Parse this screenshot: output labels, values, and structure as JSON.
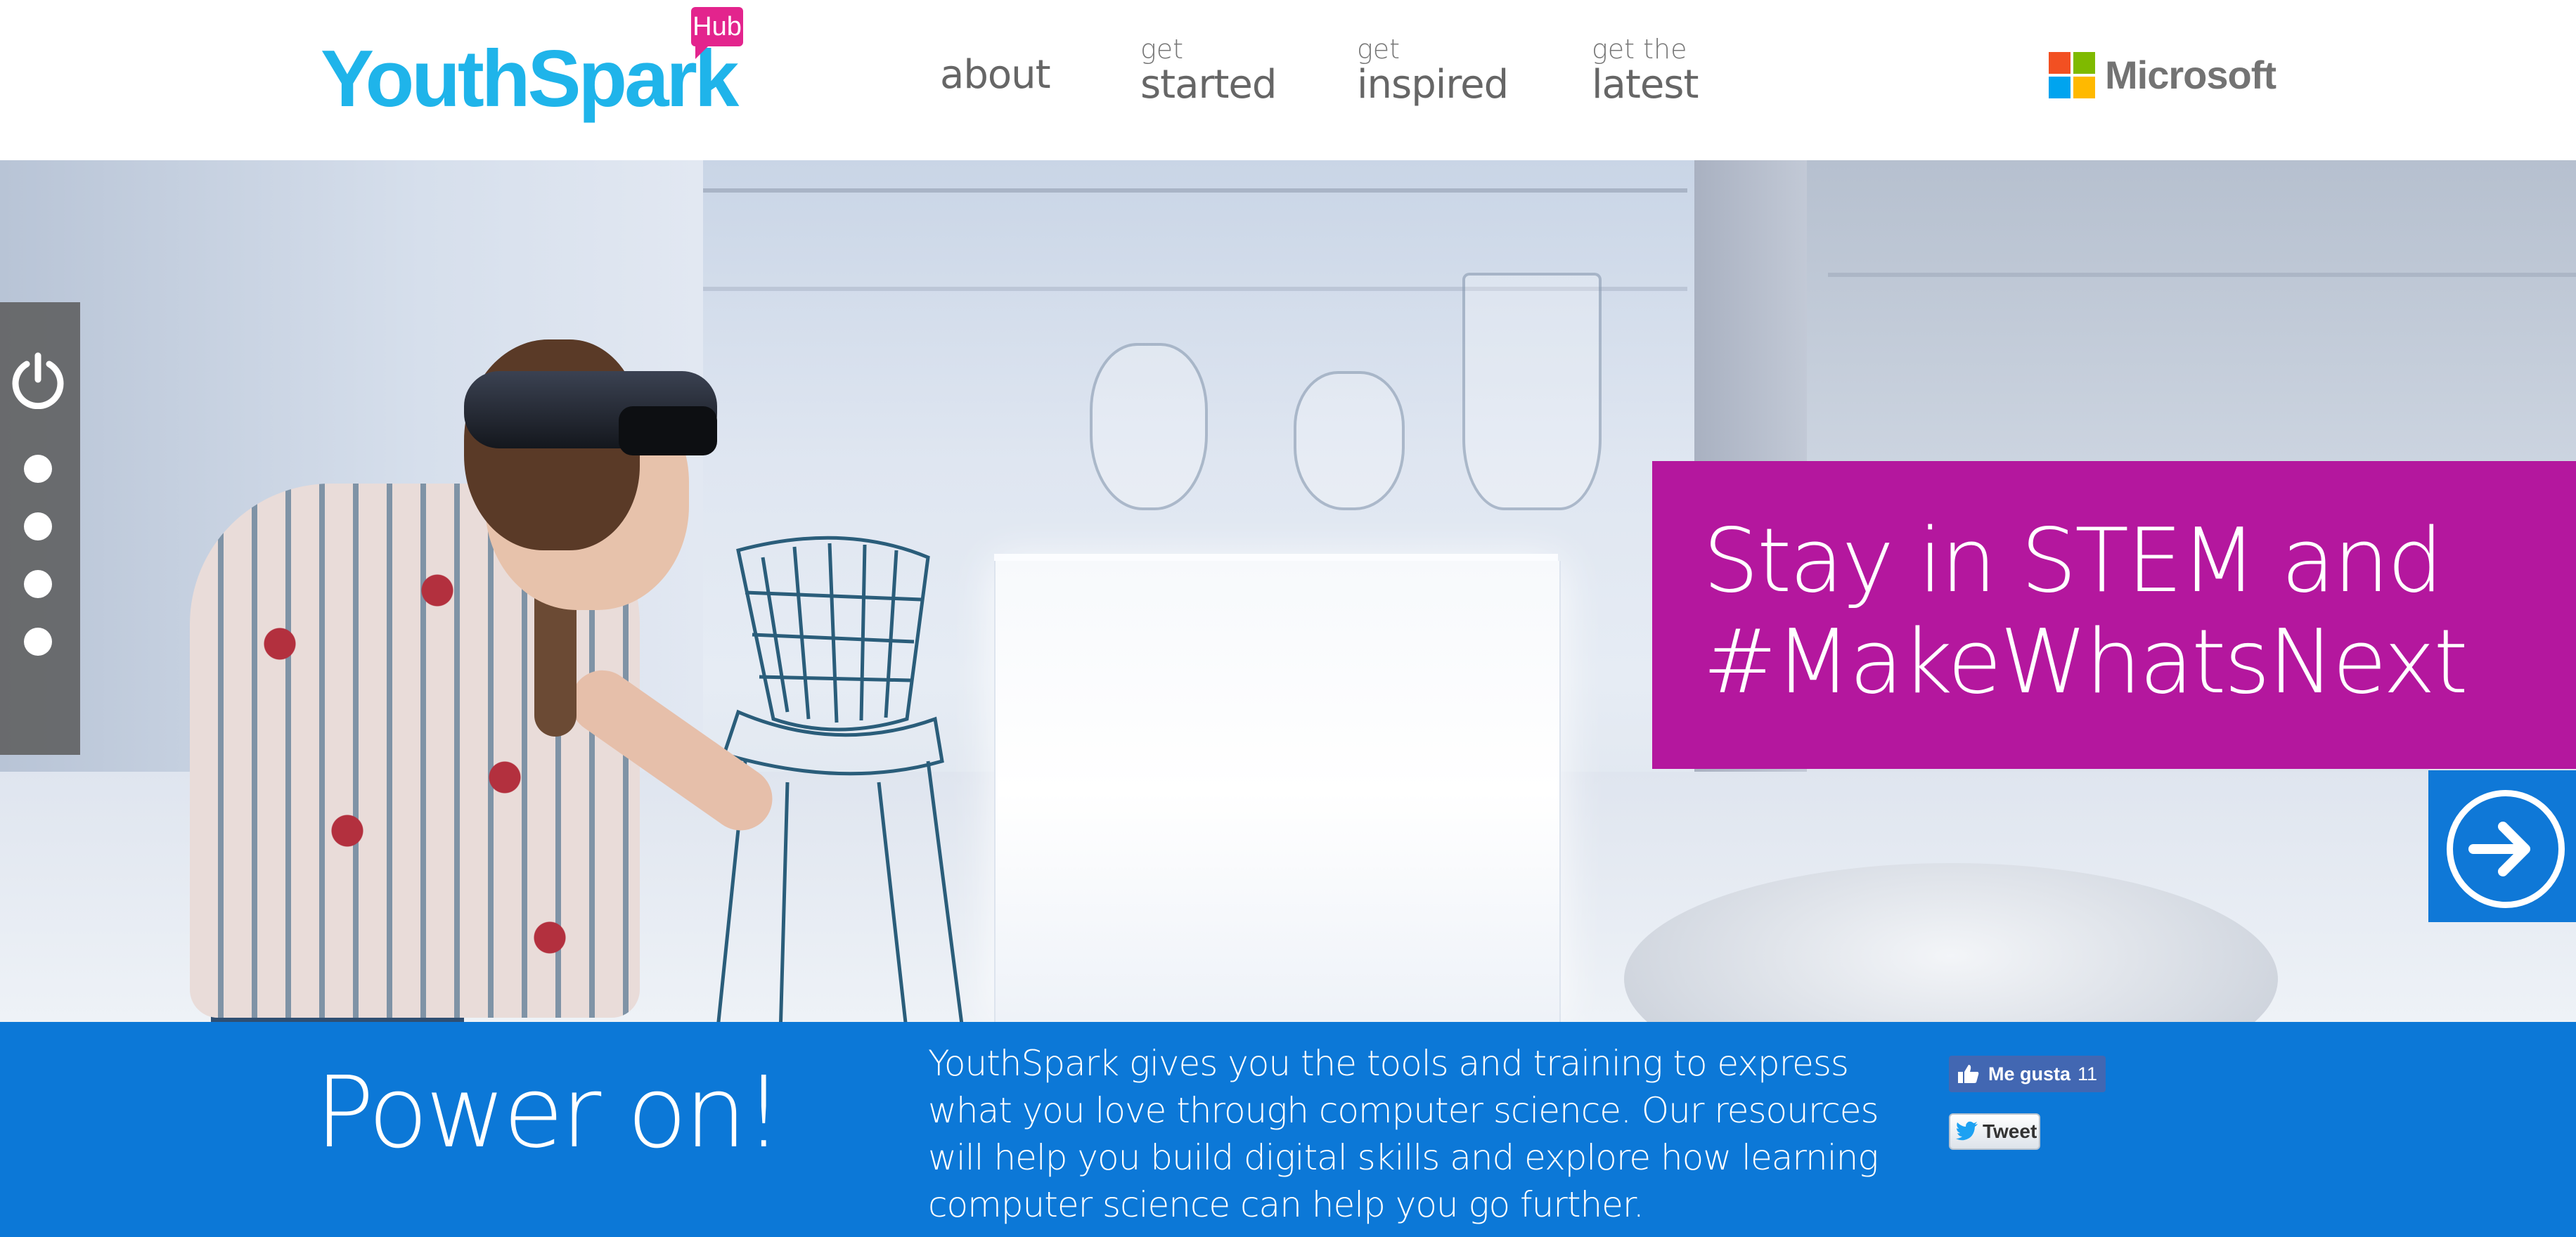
{
  "header": {
    "logo_text": "YouthSpark",
    "logo_badge": "Hub",
    "nav": [
      {
        "small": "",
        "big": "about"
      },
      {
        "small": "get",
        "big": "started"
      },
      {
        "small": "get",
        "big": "inspired"
      },
      {
        "small": "get the",
        "big": "latest"
      }
    ],
    "brand": "Microsoft",
    "brand_colors": [
      "#f25022",
      "#7fba00",
      "#00a4ef",
      "#ffb900"
    ]
  },
  "hero": {
    "promo_text": "Stay in STEM and #MakeWhatsNext",
    "promo_color": "#b4179e",
    "rail": {
      "icon": "power-icon",
      "dots": 4
    },
    "next_icon": "arrow-right-circle-icon"
  },
  "band": {
    "title": "Power on!",
    "description": "YouthSpark gives you the tools and training to express what you love through computer science. Our resources will help you build digital skills and explore how learning computer science can help you go further.",
    "color": "#0c78d7",
    "like_label": "Me gusta",
    "like_count": "11",
    "tweet_label": "Tweet"
  }
}
